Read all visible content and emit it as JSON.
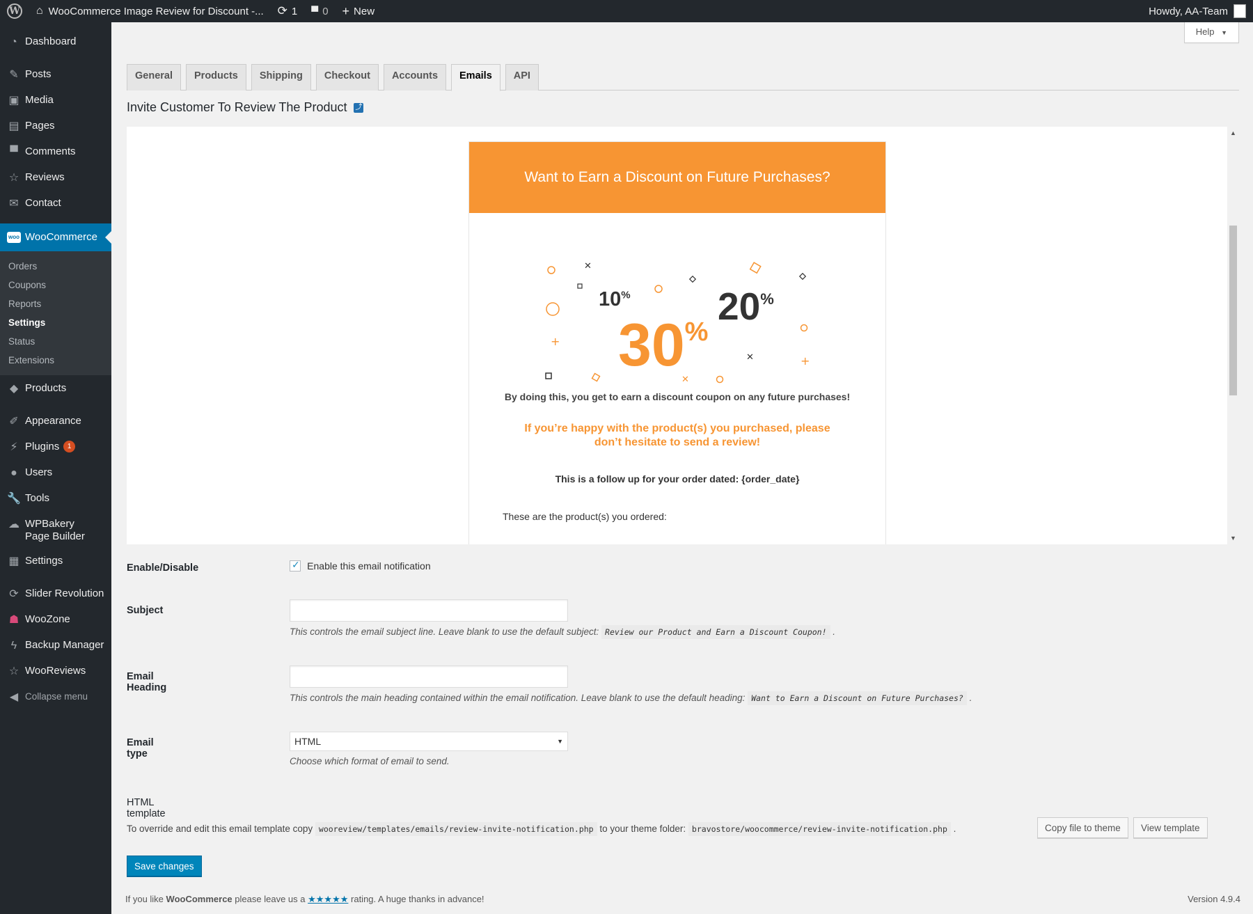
{
  "adminbar": {
    "site_title": "WooCommerce Image Review for Discount -...",
    "updates_count": "1",
    "comments_count": "0",
    "new_label": "New",
    "greeting": "Howdy, AA-Team"
  },
  "sidebar": {
    "dashboard": "Dashboard",
    "posts": "Posts",
    "media": "Media",
    "pages": "Pages",
    "comments": "Comments",
    "reviews": "Reviews",
    "contact": "Contact",
    "woocommerce": "WooCommerce",
    "woo_sub": [
      "Orders",
      "Coupons",
      "Reports",
      "Settings",
      "Status",
      "Extensions"
    ],
    "products": "Products",
    "appearance": "Appearance",
    "plugins": "Plugins",
    "plugins_badge": "1",
    "users": "Users",
    "tools": "Tools",
    "wpbakery": "WPBakery Page Builder",
    "settings": "Settings",
    "slider": "Slider Revolution",
    "woozone": "WooZone",
    "backup": "Backup Manager",
    "wooreviews": "WooReviews",
    "collapse": "Collapse menu"
  },
  "help_label": "Help",
  "tabs": [
    "General",
    "Products",
    "Shipping",
    "Checkout",
    "Accounts",
    "Emails",
    "API"
  ],
  "section_title": "Invite Customer To Review The Product",
  "email_preview": {
    "heading": "Want to Earn a Discount on Future Purchases?",
    "pct_small": "10",
    "pct_big": "30",
    "pct_mid": "20",
    "pct_sign": "%",
    "text1": "By doing this, you get to earn a discount coupon on any future purchases!",
    "text2": "If you’re happy with the product(s) you purchased, please don’t hesitate to send a review!",
    "text3": "This is a follow up for your order dated: {order_date}",
    "text4": "These are the product(s) you ordered:"
  },
  "form": {
    "enable_label": "Enable/Disable",
    "enable_text": "Enable this email notification",
    "subject_label": "Subject",
    "subject_value": "",
    "subject_desc": "This controls the email subject line. Leave blank to use the default subject:",
    "subject_default": "Review our Product and Earn a Discount Coupon!",
    "heading_label": "Email Heading",
    "heading_value": "",
    "heading_desc": "This controls the main heading contained within the email notification. Leave blank to use the default heading:",
    "heading_default": "Want to Earn a Discount on Future Purchases?",
    "type_label": "Email type",
    "type_value": "HTML",
    "type_desc": "Choose which format of email to send.",
    "template_label": "HTML template",
    "template_text_before": "To override and edit this email template copy",
    "template_path": "wooreview/templates/emails/review-invite-notification.php",
    "template_text_mid": "to your theme folder:",
    "theme_path": "bravostore/woocommerce/review-invite-notification.php",
    "copy_button": "Copy file to theme",
    "view_button": "View template",
    "save_button": "Save changes"
  },
  "footer": {
    "before": "If you like",
    "brand": "WooCommerce",
    "mid": "please leave us a",
    "stars": "★★★★★",
    "after": "rating. A huge thanks in advance!",
    "version": "Version 4.9.4"
  },
  "colors": {
    "accent": "#0073aa",
    "email_orange": "#f79533",
    "sidebar_bg": "#23282d"
  }
}
